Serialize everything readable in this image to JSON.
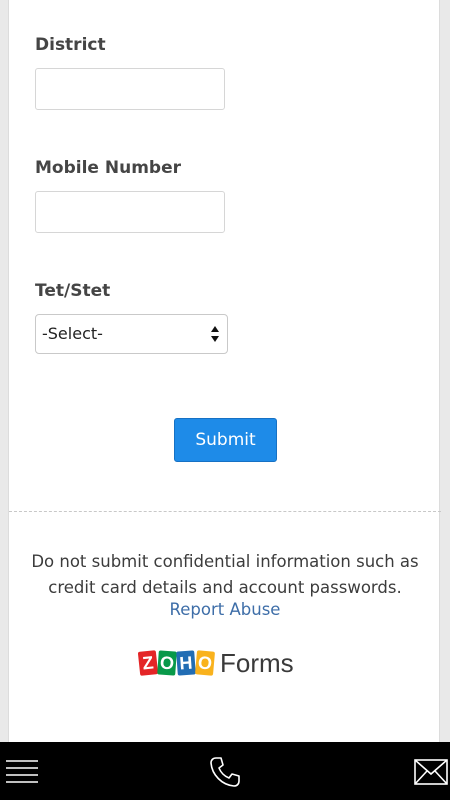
{
  "form": {
    "district_label": "District",
    "district_value": "",
    "mobile_label": "Mobile Number",
    "mobile_value": "",
    "tet_label": "Tet/Stet",
    "tet_selected": "-Select-",
    "submit_label": "Submit"
  },
  "footer": {
    "notice": "Do not submit confidential information such as credit card details and account passwords.",
    "report_abuse": "Report Abuse",
    "brand_letters": [
      "Z",
      "O",
      "H",
      "O"
    ],
    "brand_colors": [
      "#e42527",
      "#089949",
      "#226db4",
      "#f9b21d"
    ],
    "brand_product": "Forms"
  },
  "bottom_bar": {
    "icons": [
      "menu-icon",
      "phone-icon",
      "mail-icon"
    ]
  }
}
